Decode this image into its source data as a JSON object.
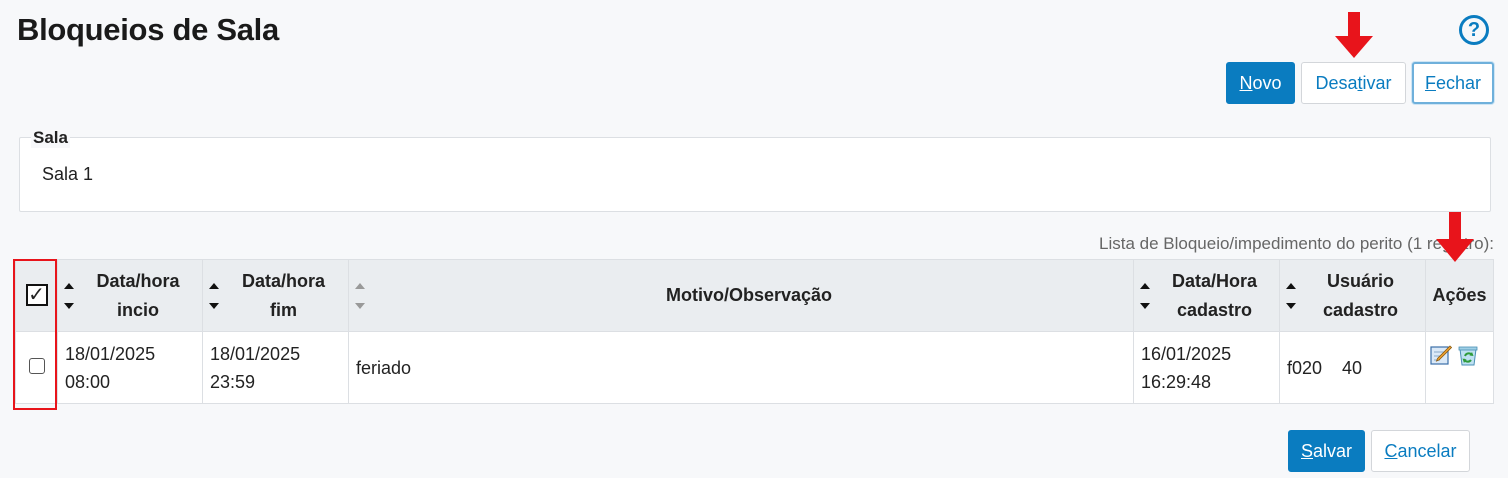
{
  "header": {
    "title": "Bloqueios de Sala",
    "help_icon": "?"
  },
  "toolbar": {
    "new": {
      "underline": "N",
      "rest": "ovo"
    },
    "deactivate": {
      "before": "Desa",
      "underline": "t",
      "after": "ivar"
    },
    "close": {
      "underline": "F",
      "rest": "echar"
    }
  },
  "sala": {
    "legend": "Sala",
    "value": "Sala 1"
  },
  "list": {
    "caption": "Lista de Bloqueio/impedimento do perito (1 registro):",
    "headers": {
      "start": [
        "Data/hora",
        "incio"
      ],
      "end": [
        "Data/hora",
        "fim"
      ],
      "reason": "Motivo/Observação",
      "created": [
        "Data/Hora",
        "cadastro"
      ],
      "user": [
        "Usuário",
        "cadastro"
      ],
      "actions": "Ações"
    },
    "rows": [
      {
        "start": [
          "18/01/2025",
          "08:00"
        ],
        "end": [
          "18/01/2025",
          "23:59"
        ],
        "reason": "feriado",
        "created": [
          "16/01/2025",
          "16:29:48"
        ],
        "user": "f020    40"
      }
    ]
  },
  "footer": {
    "save": {
      "underline": "S",
      "rest": "alvar"
    },
    "cancel": {
      "underline": "C",
      "rest": "ancelar"
    }
  },
  "colors": {
    "accent": "#0a7cc0",
    "annotation": "#e8141b"
  }
}
